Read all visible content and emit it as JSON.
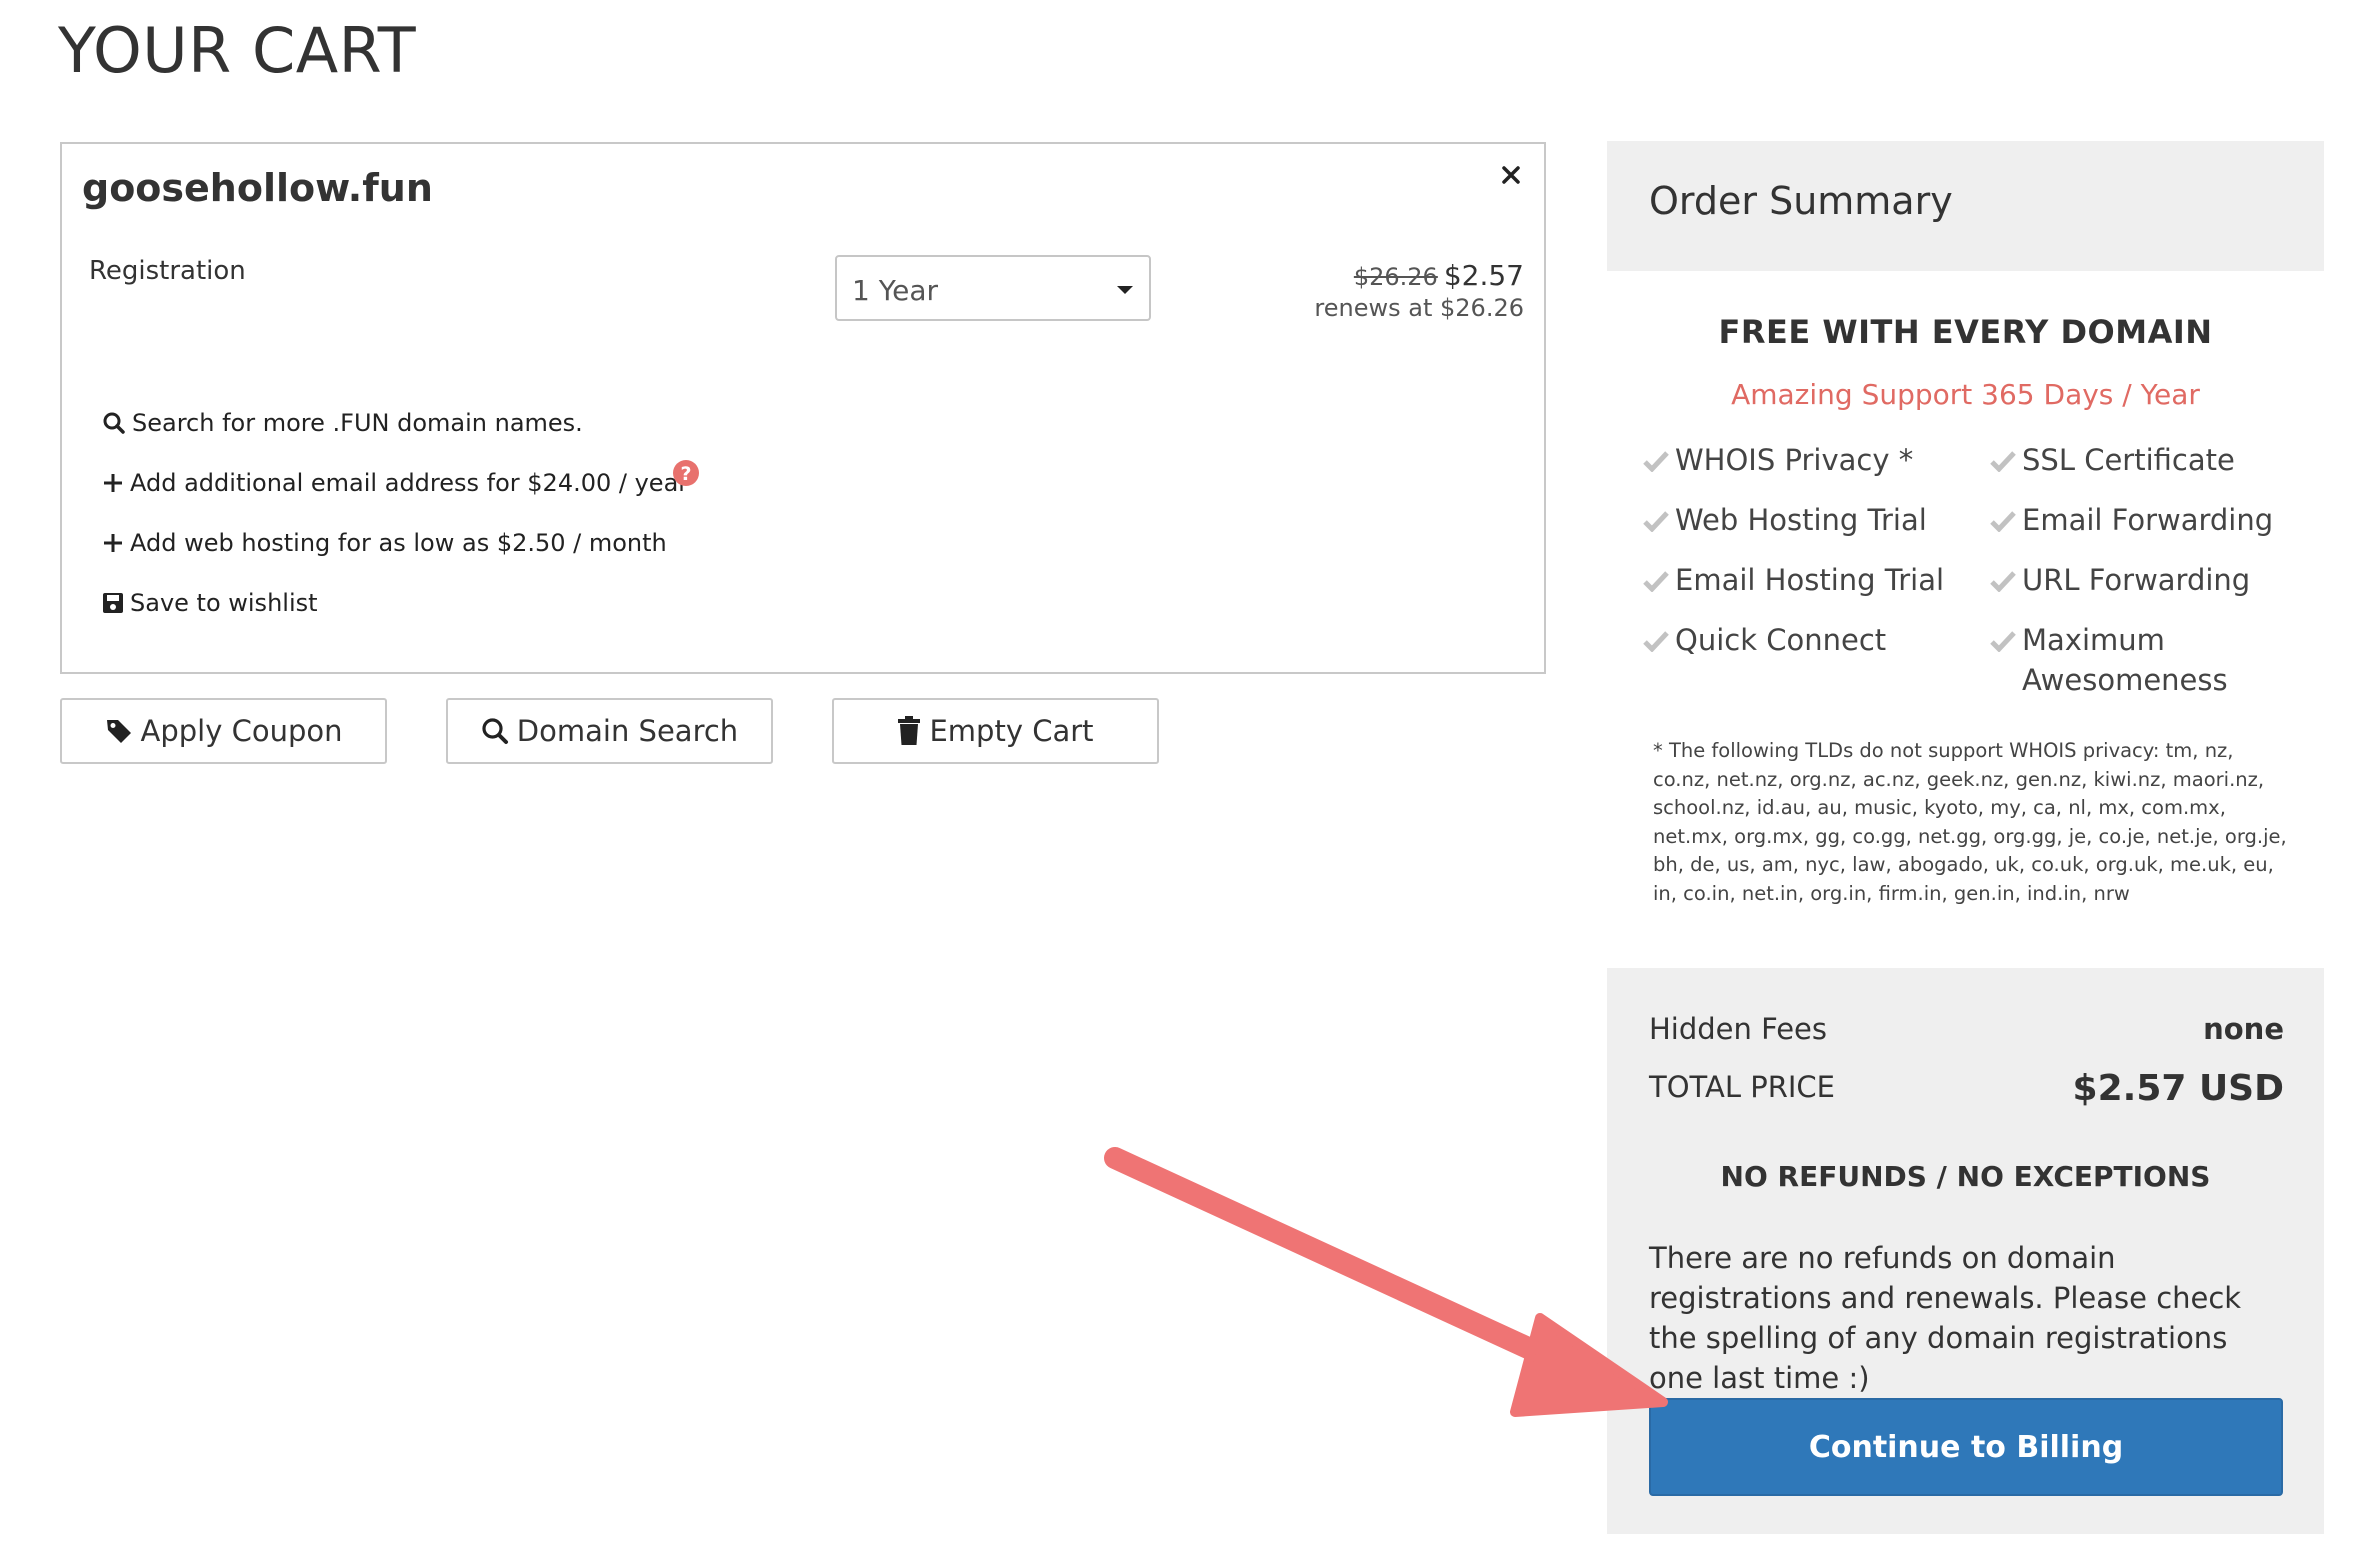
{
  "page": {
    "title": "YOUR CART"
  },
  "cart_item": {
    "domain": "goosehollow.fun",
    "registration_label": "Registration",
    "period_selected": "1 Year",
    "old_price": "$26.26",
    "new_price": "$2.57",
    "renews": "renews at $26.26",
    "options": [
      {
        "label": "Search for more .FUN domain names.",
        "icon": "search-icon"
      },
      {
        "label": "Add additional email address for $24.00 / year",
        "icon": "plus-icon"
      },
      {
        "label": "Add web hosting for as low as $2.50 / month",
        "icon": "plus-icon"
      },
      {
        "label": "Save to wishlist",
        "icon": "save-icon"
      }
    ]
  },
  "actions": {
    "apply_coupon": "Apply Coupon",
    "domain_search": "Domain Search",
    "empty_cart": "Empty Cart"
  },
  "summary": {
    "title": "Order Summary",
    "free_title": "FREE WITH EVERY DOMAIN",
    "support_line": "Amazing Support 365 Days / Year",
    "features_left": [
      "WHOIS Privacy *",
      "Web Hosting Trial",
      "Email Hosting Trial",
      "Quick Connect"
    ],
    "features_right": [
      "SSL Certificate",
      "Email Forwarding",
      "URL Forwarding",
      "Maximum Awesomeness"
    ],
    "tld_note": "* The following TLDs do not support WHOIS privacy: tm, nz, co.nz, net.nz, org.nz, ac.nz, geek.nz, gen.nz, kiwi.nz, maori.nz, school.nz, id.au, au, music, kyoto, my, ca, nl, mx, com.mx, net.mx, org.mx, gg, co.gg, net.gg, org.gg, je, co.je, net.je, org.je, bh, de, us, am, nyc, law, abogado, uk, co.uk, org.uk, me.uk, eu, in, co.in, net.in, org.in, firm.in, gen.in, ind.in, nrw",
    "hidden_fees_label": "Hidden Fees",
    "hidden_fees_value": "none",
    "total_label": "TOTAL PRICE",
    "total_value": "$2.57 USD",
    "no_refunds_title": "NO REFUNDS / NO EXCEPTIONS",
    "no_refunds_text": "There are no refunds on domain registrations and renewals. Please check the spelling of any domain registrations one last time :)",
    "billing_button": "Continue to Billing"
  },
  "colors": {
    "accent": "#2f78b9",
    "support_red": "#e06a63",
    "help_icon": "#e8716d",
    "annotation_arrow": "#ef7474",
    "panel_bg": "#efefef"
  }
}
